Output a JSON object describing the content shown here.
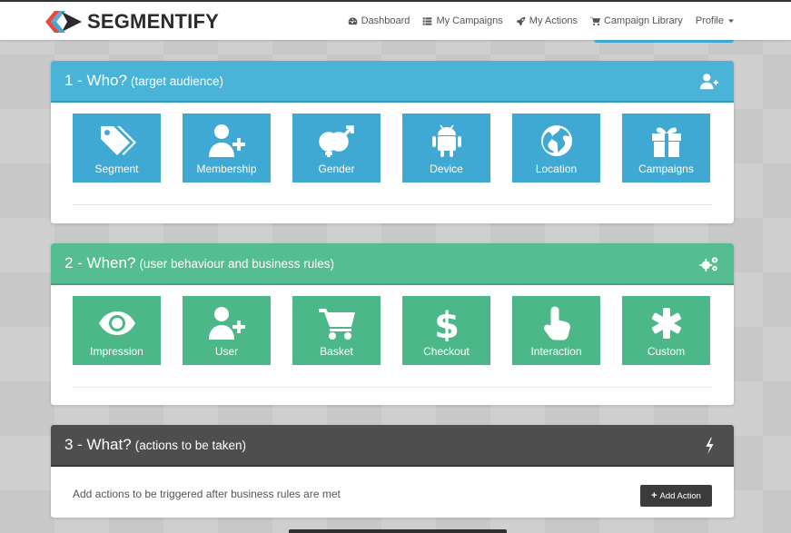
{
  "brand": {
    "name": "SEGMENTIFY"
  },
  "nav": [
    {
      "label": "Dashboard",
      "icon": "dashboard-icon"
    },
    {
      "label": "My Campaigns",
      "icon": "list-icon"
    },
    {
      "label": "My Actions",
      "icon": "rocket-icon"
    },
    {
      "label": "Campaign Library",
      "icon": "cart-icon"
    },
    {
      "label": "Profile",
      "icon": "caret-down-icon"
    }
  ],
  "sections": {
    "who": {
      "number": "1 - Who?",
      "subtitle": "(target audience)",
      "icon": "add-user-icon",
      "color": "#4ab3d8",
      "tiles": [
        {
          "label": "Segment",
          "icon": "tags-icon"
        },
        {
          "label": "Membership",
          "icon": "user-plus-icon"
        },
        {
          "label": "Gender",
          "icon": "gender-icon"
        },
        {
          "label": "Device",
          "icon": "android-icon"
        },
        {
          "label": "Location",
          "icon": "globe-icon"
        },
        {
          "label": "Campaigns",
          "icon": "gift-icon"
        }
      ]
    },
    "when": {
      "number": "2 - When?",
      "subtitle": "(user behaviour and business rules)",
      "icon": "gears-icon",
      "color": "#54bd92",
      "tiles": [
        {
          "label": "Impression",
          "icon": "eye-icon"
        },
        {
          "label": "User",
          "icon": "user-plus-icon"
        },
        {
          "label": "Basket",
          "icon": "cart-icon"
        },
        {
          "label": "Checkout",
          "icon": "dollar-icon"
        },
        {
          "label": "Interaction",
          "icon": "pointer-hand-icon"
        },
        {
          "label": "Custom",
          "icon": "asterisk-icon"
        }
      ]
    },
    "what": {
      "number": "3 - What?",
      "subtitle": "(actions to be taken)",
      "icon": "bolt-icon",
      "color": "#4e4e4e",
      "body_text": "Add actions to be triggered after business rules are met",
      "add_button": "Add Action"
    }
  }
}
